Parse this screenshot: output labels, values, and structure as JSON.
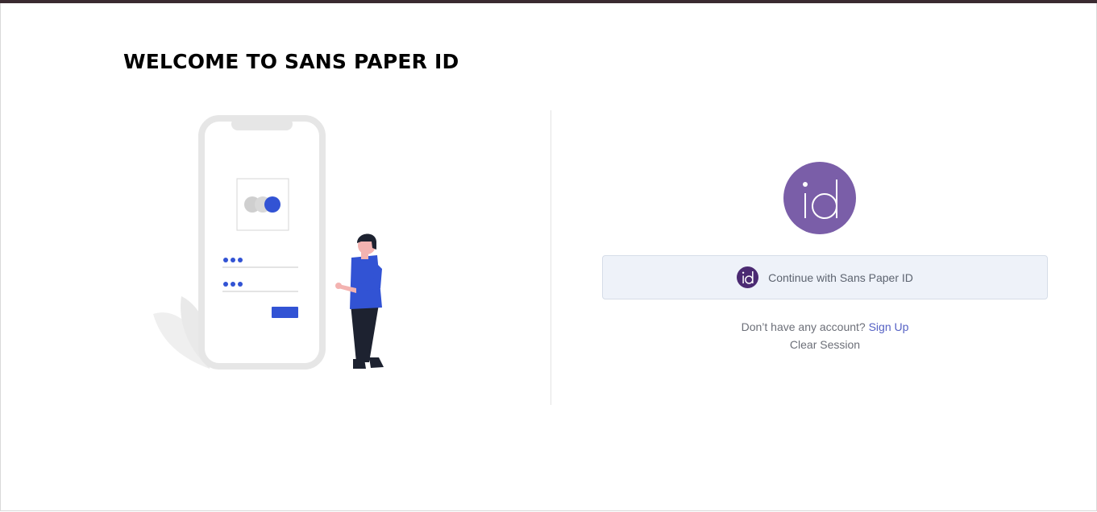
{
  "header": {
    "title": "WELCOME TO SANS PAPER ID"
  },
  "login": {
    "logo_text": "id",
    "continue_label": "Continue with Sans Paper ID",
    "no_account_text": "Don’t have any account?",
    "signup_label": "Sign Up",
    "clear_session_label": "Clear Session"
  },
  "colors": {
    "brand_purple": "#7a5ea8",
    "brand_dark_purple": "#4b2a72",
    "accent_blue": "#3253d4",
    "link_color": "#5561c4",
    "button_bg": "#eef2f9"
  }
}
